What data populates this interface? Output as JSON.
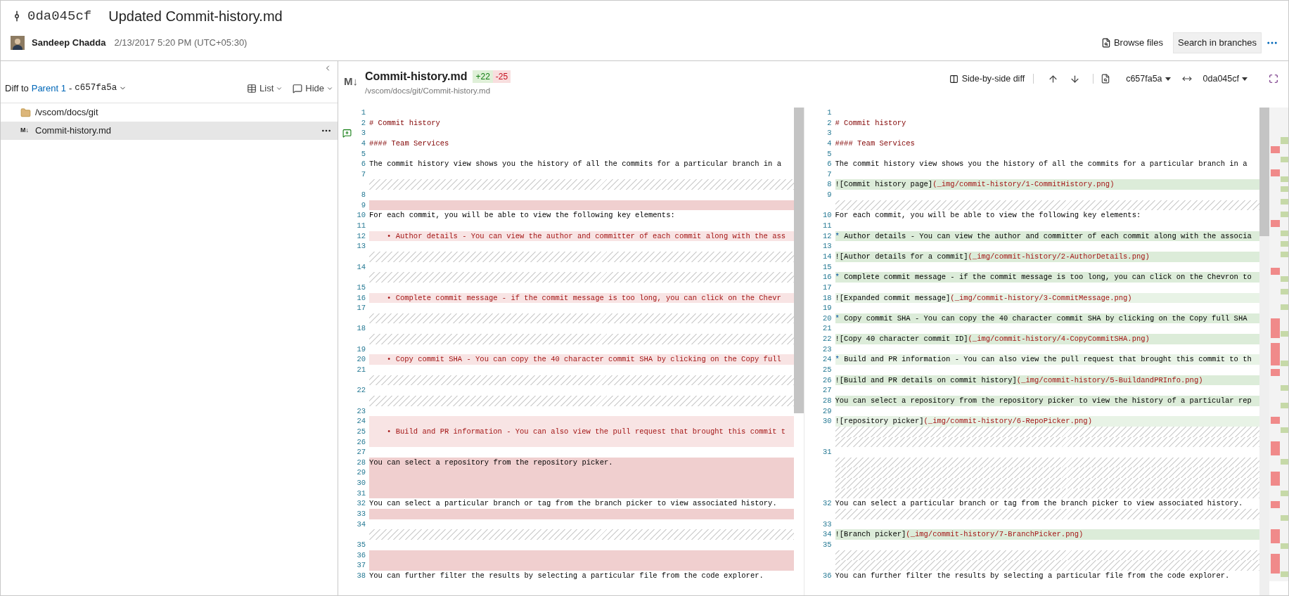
{
  "commit": {
    "id": "0da045cf",
    "title": "Updated Commit-history.md",
    "author": "Sandeep Chadda",
    "date": "2/13/2017 5:20 PM (UTC+05:30)"
  },
  "header_actions": [
    {
      "kind": "browse",
      "label": "Browse files"
    },
    {
      "kind": "search",
      "label": "Search in branches"
    },
    {
      "kind": "more"
    }
  ],
  "diff_to": {
    "prefix": "Diff to",
    "parent": "Parent 1",
    "separator": "-",
    "hash": "c657fa5a"
  },
  "view_buttons": [
    {
      "kind": "list",
      "label": "List"
    },
    {
      "kind": "hide",
      "label": "Hide"
    }
  ],
  "tree": [
    {
      "kind": "folder",
      "label": "/vscom/docs/git",
      "selected": false
    },
    {
      "kind": "markdown",
      "icon_text": "M↓",
      "label": "Commit-history.md",
      "selected": true
    }
  ],
  "file": {
    "icon_text": "M↓",
    "name": "Commit-history.md",
    "added": "+22",
    "removed": "-25",
    "path": "/vscom/docs/git/Commit-history.md"
  },
  "toolbar": {
    "view": "Side-by-side diff",
    "base": "c657fa5a",
    "target": "0da045cf"
  },
  "left_lines": [
    {
      "kind": "blank",
      "n": "1",
      "deleted": false,
      "partial": false,
      "add_comment": false
    },
    {
      "kind": "heading",
      "n": "2",
      "text": "# Commit history",
      "deleted": false,
      "partial": false,
      "add_comment": false
    },
    {
      "kind": "blank",
      "n": "3",
      "deleted": false,
      "partial": false,
      "add_comment": true
    },
    {
      "kind": "heading",
      "n": "4",
      "text": "#### Team Services",
      "deleted": false,
      "partial": false,
      "add_comment": false
    },
    {
      "kind": "blank",
      "n": "5",
      "deleted": false,
      "partial": false,
      "add_comment": false
    },
    {
      "kind": "text",
      "n": "6",
      "text": "The commit history view shows you the history of all the commits for a particular branch in a",
      "deleted": false,
      "partial": false,
      "add_comment": false
    },
    {
      "kind": "blank",
      "n": "7",
      "deleted": false,
      "partial": false,
      "add_comment": false
    },
    {
      "kind": "spacer"
    },
    {
      "kind": "blank",
      "n": "8",
      "deleted": false,
      "partial": false,
      "add_comment": false
    },
    {
      "kind": "blank",
      "n": "9",
      "deleted": true,
      "partial": false,
      "add_comment": false
    },
    {
      "kind": "text",
      "n": "10",
      "text": "For each commit, you will be able to view the following key elements:",
      "deleted": false,
      "partial": false,
      "add_comment": false
    },
    {
      "kind": "blank",
      "n": "11",
      "deleted": false,
      "partial": false,
      "add_comment": false
    },
    {
      "kind": "bullet",
      "n": "12",
      "marker": "•",
      "text": "Author details - You can view the author and committer of each commit along with the ass",
      "deleted": true,
      "partial": true,
      "add_comment": false
    },
    {
      "kind": "blank",
      "n": "13",
      "deleted": false,
      "partial": false,
      "add_comment": false
    },
    {
      "kind": "spacer"
    },
    {
      "kind": "blank",
      "n": "14",
      "deleted": false,
      "partial": false,
      "add_comment": false
    },
    {
      "kind": "spacer"
    },
    {
      "kind": "blank",
      "n": "15",
      "deleted": false,
      "partial": false,
      "add_comment": false
    },
    {
      "kind": "bullet",
      "n": "16",
      "marker": "•",
      "text": "Complete commit message - if the commit message is too long, you can click on the Chevr",
      "deleted": true,
      "partial": true,
      "add_comment": false
    },
    {
      "kind": "blank",
      "n": "17",
      "deleted": false,
      "partial": false,
      "add_comment": false
    },
    {
      "kind": "spacer"
    },
    {
      "kind": "blank",
      "n": "18",
      "deleted": false,
      "partial": false,
      "add_comment": false
    },
    {
      "kind": "spacer"
    },
    {
      "kind": "blank",
      "n": "19",
      "deleted": false,
      "partial": false,
      "add_comment": false
    },
    {
      "kind": "bullet",
      "n": "20",
      "marker": "•",
      "text": "Copy commit SHA - You can copy the 40 character commit SHA by clicking on the Copy full",
      "deleted": true,
      "partial": true,
      "add_comment": false
    },
    {
      "kind": "blank",
      "n": "21",
      "deleted": false,
      "partial": false,
      "add_comment": false
    },
    {
      "kind": "spacer"
    },
    {
      "kind": "blank",
      "n": "22",
      "deleted": false,
      "partial": false,
      "add_comment": false
    },
    {
      "kind": "spacer"
    },
    {
      "kind": "blank",
      "n": "23",
      "deleted": false,
      "partial": false,
      "add_comment": false
    },
    {
      "kind": "blank",
      "n": "24",
      "deleted": true,
      "partial": true,
      "add_comment": false
    },
    {
      "kind": "bullet",
      "n": "25",
      "marker": "•",
      "text": "Build and PR information - You can also view the pull request that brought this commit t",
      "deleted": true,
      "partial": true,
      "add_comment": false
    },
    {
      "kind": "blank",
      "n": "26",
      "deleted": true,
      "partial": true,
      "add_comment": false
    },
    {
      "kind": "blank",
      "n": "27",
      "deleted": false,
      "partial": false,
      "add_comment": false
    },
    {
      "kind": "text",
      "n": "28",
      "text": "You can select a repository from the repository picker.",
      "deleted": true,
      "partial": false,
      "add_comment": false
    },
    {
      "kind": "blank",
      "n": "29",
      "deleted": true,
      "partial": false,
      "add_comment": false
    },
    {
      "kind": "blank",
      "n": "30",
      "deleted": true,
      "partial": false,
      "add_comment": false
    },
    {
      "kind": "blank",
      "n": "31",
      "deleted": true,
      "partial": false,
      "add_comment": false
    },
    {
      "kind": "text",
      "n": "32",
      "text": "You can select a particular branch or tag from the branch picker to view associated history.",
      "deleted": false,
      "partial": false,
      "add_comment": false
    },
    {
      "kind": "blank",
      "n": "33",
      "deleted": true,
      "partial": false,
      "add_comment": false
    },
    {
      "kind": "blank",
      "n": "34",
      "deleted": false,
      "partial": false,
      "add_comment": false
    },
    {
      "kind": "spacer"
    },
    {
      "kind": "blank",
      "n": "35",
      "deleted": false,
      "partial": false,
      "add_comment": false
    },
    {
      "kind": "blank",
      "n": "36",
      "deleted": true,
      "partial": false,
      "add_comment": false
    },
    {
      "kind": "blank",
      "n": "37",
      "deleted": true,
      "partial": false,
      "add_comment": false
    },
    {
      "kind": "text",
      "n": "38",
      "text": "You can further filter the results by selecting a particular file from the code explorer.",
      "deleted": false,
      "partial": false,
      "add_comment": false
    }
  ],
  "right_lines": [
    {
      "kind": "blank",
      "n": "1",
      "inserted": false,
      "partial": false
    },
    {
      "kind": "heading",
      "n": "2",
      "text": "# Commit history",
      "inserted": false,
      "partial": false
    },
    {
      "kind": "blank",
      "n": "3",
      "inserted": false,
      "partial": false
    },
    {
      "kind": "heading",
      "n": "4",
      "text": "#### Team Services",
      "inserted": false,
      "partial": false
    },
    {
      "kind": "blank",
      "n": "5",
      "inserted": false,
      "partial": false
    },
    {
      "kind": "text",
      "n": "6",
      "text": "The commit history view shows you the history of all the commits for a particular branch in a",
      "inserted": false,
      "partial": false
    },
    {
      "kind": "blank",
      "n": "7",
      "inserted": false,
      "partial": false
    },
    {
      "kind": "image",
      "n": "8",
      "text": "![Commit history page]",
      "url": "(_img/commit-history/1-CommitHistory.png)",
      "inserted": true,
      "partial": false
    },
    {
      "kind": "blank",
      "n": "9",
      "inserted": false,
      "partial": false
    },
    {
      "kind": "spacer"
    },
    {
      "kind": "text",
      "n": "10",
      "text": "For each commit, you will be able to view the following key elements:",
      "inserted": false,
      "partial": false
    },
    {
      "kind": "blank",
      "n": "11",
      "inserted": false,
      "partial": false
    },
    {
      "kind": "bullet",
      "n": "12",
      "marker": "*",
      "text": "Author details - You can view the author and committer of each commit along with the associa",
      "inserted": true,
      "partial": false
    },
    {
      "kind": "blank",
      "n": "13",
      "inserted": false,
      "partial": false
    },
    {
      "kind": "image",
      "n": "14",
      "text": "![Author details for a commit]",
      "url": "(_img/commit-history/2-AuthorDetails.png)",
      "inserted": true,
      "partial": false
    },
    {
      "kind": "blank",
      "n": "15",
      "inserted": false,
      "partial": false
    },
    {
      "kind": "bullet",
      "n": "16",
      "marker": "*",
      "text": "Complete commit message - if the commit message is too long, you can click on the Chevron to",
      "inserted": true,
      "partial": false
    },
    {
      "kind": "blank",
      "n": "17",
      "inserted": false,
      "partial": false
    },
    {
      "kind": "image",
      "n": "18",
      "text": "![Expanded commit message]",
      "url": "(_img/commit-history/3-CommitMessage.png)",
      "inserted": true,
      "partial": true
    },
    {
      "kind": "blank",
      "n": "19",
      "inserted": false,
      "partial": false
    },
    {
      "kind": "bullet",
      "n": "20",
      "marker": "*",
      "text": "Copy commit SHA - You can copy the 40 character commit SHA by clicking on the Copy full SHA",
      "inserted": true,
      "partial": false
    },
    {
      "kind": "blank",
      "n": "21",
      "inserted": false,
      "partial": false
    },
    {
      "kind": "image",
      "n": "22",
      "text": "![Copy 40 character commit ID]",
      "url": "(_img/commit-history/4-CopyCommitSHA.png)",
      "inserted": true,
      "partial": false
    },
    {
      "kind": "blank",
      "n": "23",
      "inserted": false,
      "partial": false
    },
    {
      "kind": "bullet",
      "n": "24",
      "marker": "*",
      "text": "Build and PR information - You can also view the pull request that brought this commit to th",
      "inserted": true,
      "partial": true
    },
    {
      "kind": "blank",
      "n": "25",
      "inserted": false,
      "partial": false
    },
    {
      "kind": "image",
      "n": "26",
      "text": "![Build and PR details on commit history]",
      "url": "(_img/commit-history/5-BuildandPRInfo.png)",
      "inserted": true,
      "partial": false
    },
    {
      "kind": "blank",
      "n": "27",
      "inserted": false,
      "partial": false
    },
    {
      "kind": "text",
      "n": "28",
      "text": "You can select a repository from the repository picker to view the history of a particular rep",
      "inserted": true,
      "partial": false
    },
    {
      "kind": "blank",
      "n": "29",
      "inserted": false,
      "partial": false
    },
    {
      "kind": "image",
      "n": "30",
      "text": "![repository picker]",
      "url": "(_img/commit-history/6-RepoPicker.png)",
      "inserted": true,
      "partial": true
    },
    {
      "kind": "spacer"
    },
    {
      "kind": "spacer"
    },
    {
      "kind": "blank",
      "n": "31",
      "inserted": false,
      "partial": false
    },
    {
      "kind": "spacer"
    },
    {
      "kind": "spacer"
    },
    {
      "kind": "spacer"
    },
    {
      "kind": "spacer"
    },
    {
      "kind": "text",
      "n": "32",
      "text": "You can select a particular branch or tag from the branch picker to view associated history.",
      "inserted": false,
      "partial": false
    },
    {
      "kind": "spacer"
    },
    {
      "kind": "blank",
      "n": "33",
      "inserted": false,
      "partial": false
    },
    {
      "kind": "image",
      "n": "34",
      "text": "![Branch picker]",
      "url": "(_img/commit-history/7-BranchPicker.png)",
      "inserted": true,
      "partial": false
    },
    {
      "kind": "blank",
      "n": "35",
      "inserted": false,
      "partial": false
    },
    {
      "kind": "spacer"
    },
    {
      "kind": "spacer"
    },
    {
      "kind": "text",
      "n": "36",
      "text": "You can further filter the results by selecting a particular file from the code explorer.",
      "inserted": false,
      "partial": false
    }
  ]
}
